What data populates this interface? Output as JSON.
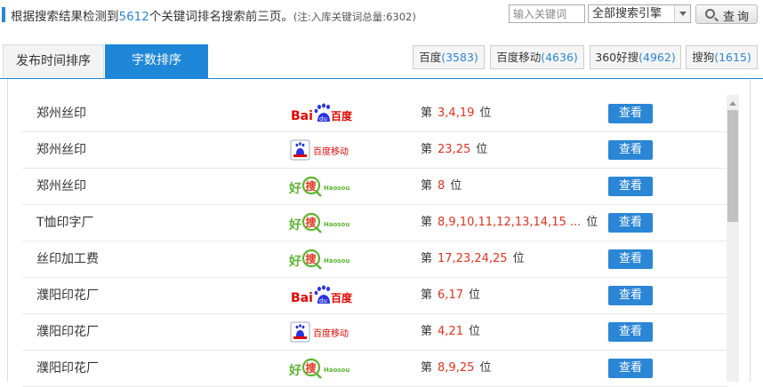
{
  "header": {
    "summary_prefix": "根据搜索结果检测到",
    "summary_count": "5612",
    "summary_suffix": "个关键词排名搜索前三页。",
    "note": "(注:入库关键词总量:6302)",
    "keyword_placeholder": "输入关键词",
    "engine_selected": "全部搜索引擎",
    "query_label": "查询"
  },
  "tabs": {
    "time_label": "发布时间排序",
    "count_label": "字数排序"
  },
  "engines": [
    {
      "name": "百度",
      "count": "(3583)"
    },
    {
      "name": "百度移动",
      "count": "(4636)"
    },
    {
      "name": "360好搜",
      "count": "(4962)"
    },
    {
      "name": "搜狗",
      "count": "(1615)"
    }
  ],
  "logo_text": {
    "baidu_bai": "Bai",
    "baidu_cn": "百度",
    "baidu_mobile": "百度移动",
    "haosou_hao": "好",
    "haosou_sou": "搜",
    "haosou_en": "Haosou"
  },
  "rank_prefix": "第",
  "rank_suffix": "位",
  "view_label": "查看",
  "rows": [
    {
      "keyword": "郑州丝印",
      "engine": "baidu-logo",
      "positions": "3,4,19"
    },
    {
      "keyword": "郑州丝印",
      "engine": "baidu-mobile-logo",
      "positions": "23,25"
    },
    {
      "keyword": "郑州丝印",
      "engine": "haosou-logo",
      "positions": "8"
    },
    {
      "keyword": "T恤印字厂",
      "engine": "haosou-logo",
      "positions": "8,9,10,11,12,13,14,15 ..."
    },
    {
      "keyword": "丝印加工费",
      "engine": "haosou-logo",
      "positions": "17,23,24,25"
    },
    {
      "keyword": "濮阳印花厂",
      "engine": "baidu-logo",
      "positions": "6,17"
    },
    {
      "keyword": "濮阳印花厂",
      "engine": "baidu-mobile-logo",
      "positions": "4,21"
    },
    {
      "keyword": "濮阳印花厂",
      "engine": "haosou-logo",
      "positions": "8,9,25"
    }
  ],
  "colors": {
    "accent": "#1e87d7",
    "count_blue": "#2b84d8",
    "rank_red": "#e0331c"
  }
}
